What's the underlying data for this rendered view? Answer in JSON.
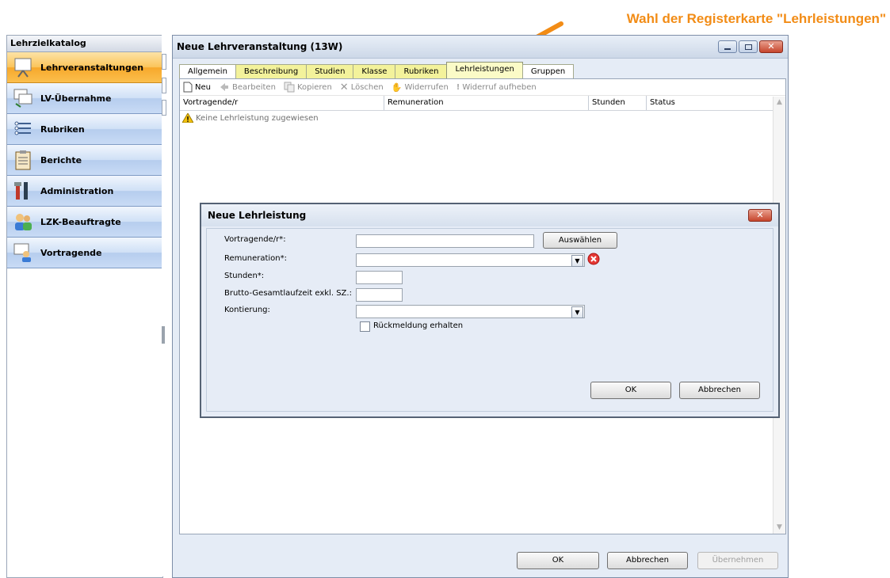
{
  "annotation": {
    "text": "Wahl der Registerkarte \"Lehrleistungen\""
  },
  "sidebar": {
    "title": "Lehrzielkatalog",
    "items": [
      {
        "label": "Lehrveranstaltungen",
        "icon": "presentation-board-icon"
      },
      {
        "label": "LV-Übernahme",
        "icon": "board-transfer-icon"
      },
      {
        "label": "Rubriken",
        "icon": "list-icon"
      },
      {
        "label": "Berichte",
        "icon": "clipboard-icon"
      },
      {
        "label": "Administration",
        "icon": "tools-icon"
      },
      {
        "label": "LZK-Beauftragte",
        "icon": "people-icon"
      },
      {
        "label": "Vortragende",
        "icon": "presenter-icon"
      }
    ]
  },
  "window": {
    "title": "Neue Lehrveranstaltung (13W)",
    "tabs": [
      "Allgemein",
      "Beschreibung",
      "Studien",
      "Klasse",
      "Rubriken",
      "Lehrleistungen",
      "Gruppen"
    ],
    "toolbar": {
      "new": "Neu",
      "edit": "Bearbeiten",
      "copy": "Kopieren",
      "delete": "Löschen",
      "revoke": "Widerrufen",
      "unrevoke": "Widerruf aufheben"
    },
    "columns": [
      "Vortragende/r",
      "Remuneration",
      "Stunden",
      "Status"
    ],
    "empty_message": "Keine Lehrleistung zugewiesen",
    "buttons": {
      "ok": "OK",
      "cancel": "Abbrechen",
      "apply": "Übernehmen"
    }
  },
  "dialog": {
    "title": "Neue Lehrleistung",
    "labels": {
      "lecturer": "Vortragende/r*:",
      "remuneration": "Remuneration*:",
      "hours": "Stunden*:",
      "gross": "Brutto-Gesamtlaufzeit exkl. SZ.:",
      "account": "Kontierung:"
    },
    "values": {
      "lecturer": "",
      "remuneration": "",
      "hours": "",
      "gross": "",
      "account": ""
    },
    "select_button": "Auswählen",
    "checkbox_label": "Rückmeldung erhalten",
    "buttons": {
      "ok": "OK",
      "cancel": "Abbrechen"
    }
  },
  "colors": {
    "accent": "#f28c16",
    "tab_yellow": "#f3f29b",
    "nav_blue": "#c8dbf5",
    "nav_active": "#fbbf4d"
  }
}
